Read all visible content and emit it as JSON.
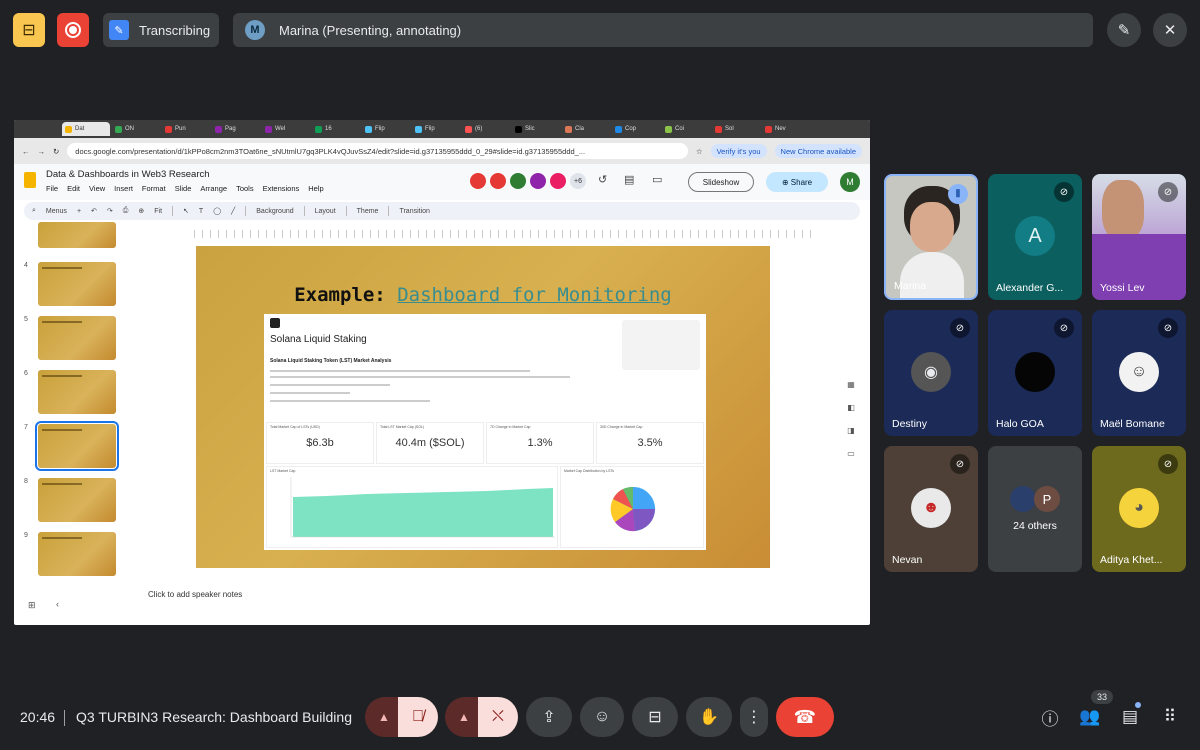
{
  "top": {
    "transcribing_label": "Transcribing",
    "presenter_initial": "M",
    "presenting_label": "Marina (Presenting, annotating)"
  },
  "browser": {
    "tabs": [
      "Dat",
      "ON",
      "Pun",
      "Pag",
      "Wel",
      "16",
      "Flip",
      "Flip",
      "(6)",
      "Slic",
      "Cla",
      "Cop",
      "Coi",
      "Sol",
      "Nev"
    ],
    "url": "docs.google.com/presentation/d/1kPPo8cm2nm3TOat6ne_sNUtmlU7gq3PLK4vQJuvSsZ4/edit?slide=id.g37135955ddd_0_29#slide=id.g37135955ddd_...",
    "verify_label": "Verify it's you",
    "new_chrome_label": "New Chrome available"
  },
  "slides": {
    "doc_title": "Data & Dashboards in Web3 Research",
    "menu": [
      "File",
      "Edit",
      "View",
      "Insert",
      "Format",
      "Slide",
      "Arrange",
      "Tools",
      "Extensions",
      "Help"
    ],
    "collab_extra": "+6",
    "slideshow_label": "Slideshow",
    "share_label": "Share",
    "user_initial": "M",
    "toolbar": {
      "menus": "Menus",
      "zoom": "Fit",
      "background": "Background",
      "layout": "Layout",
      "theme": "Theme",
      "transition": "Transition"
    },
    "thumb_numbers": [
      "4",
      "5",
      "6",
      "7",
      "8",
      "9"
    ],
    "speaker_notes_placeholder": "Click to add speaker notes"
  },
  "slide": {
    "title_prefix": "Example:",
    "title_link": "Dashboard for Monitoring",
    "dashboard": {
      "heading": "Solana Liquid Staking",
      "subheading": "Solana Liquid Staking Token (LST) Market Analysis",
      "metrics": [
        {
          "label": "Total Market Cap of LSTs (USD)",
          "value": "$6.3b"
        },
        {
          "label": "Total LST Market Cap (SOL)",
          "value": "40.4m ($SOL)"
        },
        {
          "label": "7D Change in Market Cap",
          "value": "1.3%"
        },
        {
          "label": "30D Change in Market Cap",
          "value": "3.5%"
        }
      ],
      "area_chart_label": "LST Market Cap",
      "pie_chart_label": "Market Cap Distribution by LSTs"
    }
  },
  "participants": [
    {
      "name": "Marina",
      "state": "speaking"
    },
    {
      "name": "Alexander G...",
      "initial": "A",
      "state": "muted"
    },
    {
      "name": "Yossi Lev",
      "state": "muted"
    },
    {
      "name": "Destiny",
      "state": "muted"
    },
    {
      "name": "Halo GOA",
      "state": "muted"
    },
    {
      "name": "Maël Bomane",
      "state": "muted"
    },
    {
      "name": "Nevan",
      "state": "muted"
    },
    {
      "name": "24 others",
      "initial": "P"
    },
    {
      "name": "Aditya Khet...",
      "state": "muted"
    }
  ],
  "bottom": {
    "time": "20:46",
    "meeting_title": "Q3 TURBIN3 Research: Dashboard Building",
    "people_count": "33"
  },
  "colors": {
    "accent_red": "#ea4335",
    "captions_yellow": "#f9c74f",
    "slide_gold": "#d8b04f",
    "link_teal": "#3a8d8f",
    "chart_mint": "#7de3c3"
  }
}
